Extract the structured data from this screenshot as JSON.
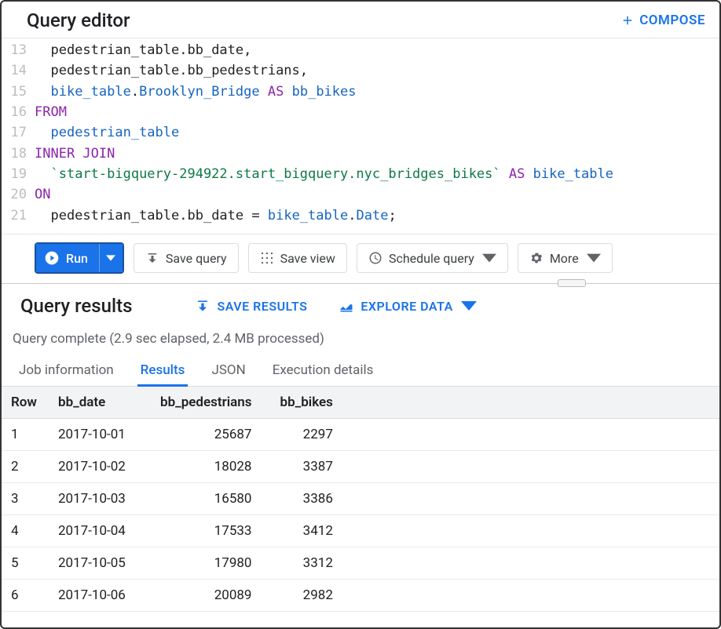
{
  "header": {
    "title": "Query editor",
    "compose_label": "COMPOSE"
  },
  "editor": {
    "lines": [
      {
        "num": 13,
        "tokens": [
          [
            "plain",
            "  pedestrian_table"
          ],
          [
            "punct",
            "."
          ],
          [
            "plain",
            "bb_date"
          ],
          [
            "punct",
            ","
          ]
        ]
      },
      {
        "num": 14,
        "tokens": [
          [
            "plain",
            "  pedestrian_table"
          ],
          [
            "punct",
            "."
          ],
          [
            "plain",
            "bb_pedestrians"
          ],
          [
            "punct",
            ","
          ]
        ]
      },
      {
        "num": 15,
        "tokens": [
          [
            "plain",
            "  "
          ],
          [
            "ident",
            "bike_table"
          ],
          [
            "punct",
            "."
          ],
          [
            "ident",
            "Brooklyn_Bridge"
          ],
          [
            "plain",
            " "
          ],
          [
            "kw",
            "AS"
          ],
          [
            "plain",
            " "
          ],
          [
            "ident",
            "bb_bikes"
          ]
        ]
      },
      {
        "num": 16,
        "tokens": [
          [
            "kw",
            "FROM"
          ]
        ]
      },
      {
        "num": 17,
        "tokens": [
          [
            "plain",
            "  "
          ],
          [
            "ident",
            "pedestrian_table"
          ]
        ]
      },
      {
        "num": 18,
        "tokens": [
          [
            "kw",
            "INNER JOIN"
          ]
        ]
      },
      {
        "num": 19,
        "tokens": [
          [
            "plain",
            "  "
          ],
          [
            "str",
            "`start-bigquery-294922.start_bigquery.nyc_bridges_bikes`"
          ],
          [
            "plain",
            " "
          ],
          [
            "kw",
            "AS"
          ],
          [
            "plain",
            " "
          ],
          [
            "ident",
            "bike_table"
          ]
        ]
      },
      {
        "num": 20,
        "tokens": [
          [
            "kw",
            "ON"
          ]
        ]
      },
      {
        "num": 21,
        "tokens": [
          [
            "plain",
            "  pedestrian_table"
          ],
          [
            "punct",
            "."
          ],
          [
            "plain",
            "bb_date "
          ],
          [
            "punct",
            "="
          ],
          [
            "plain",
            " "
          ],
          [
            "ident",
            "bike_table"
          ],
          [
            "punct",
            "."
          ],
          [
            "ident",
            "Date"
          ],
          [
            "punct",
            ";"
          ]
        ]
      }
    ]
  },
  "toolbar": {
    "run_label": "Run",
    "save_query_label": "Save query",
    "save_view_label": "Save view",
    "schedule_label": "Schedule query",
    "more_label": "More"
  },
  "results": {
    "title": "Query results",
    "save_results_label": "SAVE RESULTS",
    "explore_label": "EXPLORE DATA",
    "status": "Query complete (2.9 sec elapsed, 2.4 MB processed)",
    "tabs": {
      "job_info": "Job information",
      "results": "Results",
      "json": "JSON",
      "exec": "Execution details"
    },
    "columns": [
      "Row",
      "bb_date",
      "bb_pedestrians",
      "bb_bikes"
    ],
    "rows": [
      {
        "row": 1,
        "bb_date": "2017-10-01",
        "bb_pedestrians": 25687,
        "bb_bikes": 2297
      },
      {
        "row": 2,
        "bb_date": "2017-10-02",
        "bb_pedestrians": 18028,
        "bb_bikes": 3387
      },
      {
        "row": 3,
        "bb_date": "2017-10-03",
        "bb_pedestrians": 16580,
        "bb_bikes": 3386
      },
      {
        "row": 4,
        "bb_date": "2017-10-04",
        "bb_pedestrians": 17533,
        "bb_bikes": 3412
      },
      {
        "row": 5,
        "bb_date": "2017-10-05",
        "bb_pedestrians": 17980,
        "bb_bikes": 3312
      },
      {
        "row": 6,
        "bb_date": "2017-10-06",
        "bb_pedestrians": 20089,
        "bb_bikes": 2982
      }
    ]
  }
}
